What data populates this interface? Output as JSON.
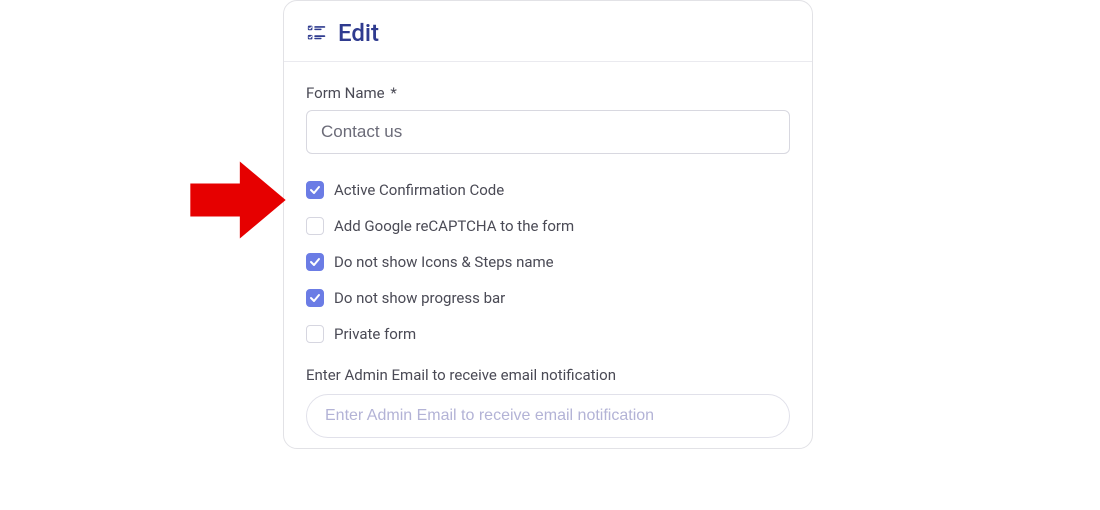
{
  "header": {
    "title": "Edit"
  },
  "form": {
    "name_label": "Form Name",
    "name_required_mark": "*",
    "name_value": "Contact us",
    "checkboxes": [
      {
        "label": "Active Confirmation Code",
        "checked": true
      },
      {
        "label": "Add Google reCAPTCHA to the form",
        "checked": false
      },
      {
        "label": "Do not show Icons & Steps name",
        "checked": true
      },
      {
        "label": "Do not show progress bar",
        "checked": true
      },
      {
        "label": "Private form",
        "checked": false
      }
    ],
    "admin_email_label": "Enter Admin Email to receive email notification",
    "admin_email_placeholder": "Enter Admin Email to receive email notification"
  },
  "colors": {
    "accent": "#6b7ce5",
    "annotation": "#e60000",
    "title": "#2f3b8f"
  }
}
